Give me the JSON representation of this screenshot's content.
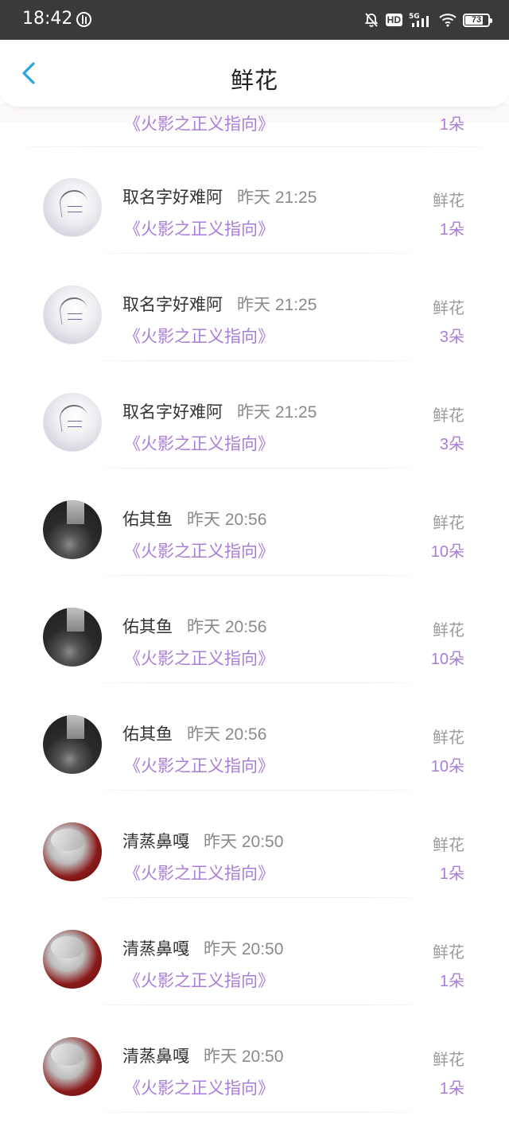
{
  "status_bar": {
    "time": "18:42",
    "network": "5G",
    "hd": "HD",
    "battery": "73"
  },
  "header": {
    "title": "鲜花"
  },
  "partial_row": {
    "book": "《火影之正义指向》",
    "count": "1朵"
  },
  "rows": [
    {
      "name": "取名字好难阿",
      "time": "昨天 21:25",
      "book": "《火影之正义指向》",
      "label": "鲜花",
      "count": "1朵",
      "avatar": "sketch"
    },
    {
      "name": "取名字好难阿",
      "time": "昨天 21:25",
      "book": "《火影之正义指向》",
      "label": "鲜花",
      "count": "3朵",
      "avatar": "sketch"
    },
    {
      "name": "取名字好难阿",
      "time": "昨天 21:25",
      "book": "《火影之正义指向》",
      "label": "鲜花",
      "count": "3朵",
      "avatar": "sketch"
    },
    {
      "name": "佑其鱼",
      "time": "昨天 20:56",
      "book": "《火影之正义指向》",
      "label": "鲜花",
      "count": "10朵",
      "avatar": "dark"
    },
    {
      "name": "佑其鱼",
      "time": "昨天 20:56",
      "book": "《火影之正义指向》",
      "label": "鲜花",
      "count": "10朵",
      "avatar": "dark"
    },
    {
      "name": "佑其鱼",
      "time": "昨天 20:56",
      "book": "《火影之正义指向》",
      "label": "鲜花",
      "count": "10朵",
      "avatar": "dark"
    },
    {
      "name": "清蒸鼻嘎",
      "time": "昨天 20:50",
      "book": "《火影之正义指向》",
      "label": "鲜花",
      "count": "1朵",
      "avatar": "red"
    },
    {
      "name": "清蒸鼻嘎",
      "time": "昨天 20:50",
      "book": "《火影之正义指向》",
      "label": "鲜花",
      "count": "1朵",
      "avatar": "red"
    },
    {
      "name": "清蒸鼻嘎",
      "time": "昨天 20:50",
      "book": "《火影之正义指向》",
      "label": "鲜花",
      "count": "1朵",
      "avatar": "red"
    }
  ],
  "colors": {
    "accent": "#a97ed8",
    "back_arrow": "#2aa3e8",
    "status_bar_bg": "#3a3a3a"
  }
}
